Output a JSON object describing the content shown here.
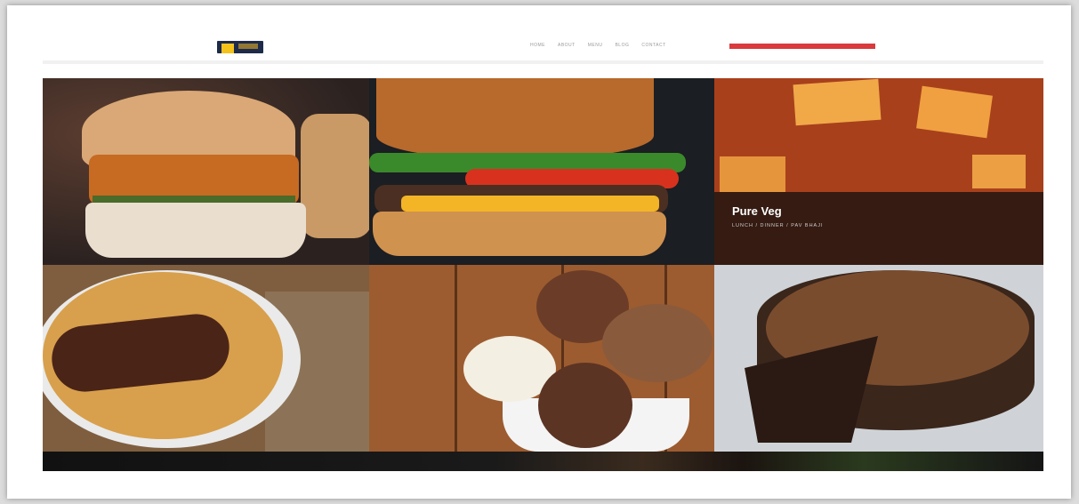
{
  "nav": {
    "items": [
      "HOME",
      "ABOUT",
      "MENU",
      "BLOG",
      "CONTACT"
    ],
    "accent_color": "#d93a3d"
  },
  "gallery": {
    "tiles": [
      {
        "id": "vada-pav"
      },
      {
        "id": "burger"
      },
      {
        "id": "paneer",
        "title": "Pure Veg",
        "subtitle": "LUNCH / DINNER / PAV BHAJI"
      },
      {
        "id": "biryani"
      },
      {
        "id": "ice-cream"
      },
      {
        "id": "chocolate-cake"
      }
    ]
  }
}
